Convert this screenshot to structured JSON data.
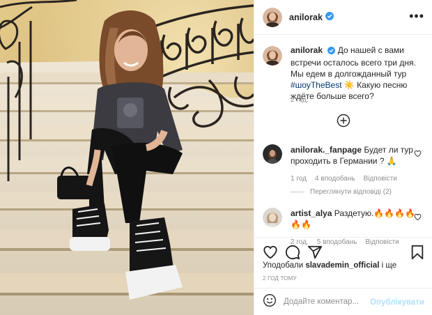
{
  "post": {
    "author": "anilorak",
    "verified": true,
    "caption": {
      "text": "До нашей с вами встречи осталось всего три дня. Мы едем в долгожданный тур",
      "hashtag": "#шоуTheBest",
      "emoji": "☀️",
      "text2": "Какую песню ждёте больше всего?"
    },
    "caption_time": "2 год.",
    "comments": [
      {
        "user": "anilorak._fanpage",
        "text": "Будет ли тур проходить в Германии ? 🙏",
        "time": "1 год",
        "likes": "4 вподобань",
        "reply": "Відповісти"
      },
      {
        "user": "artist_alya",
        "text": "Раздетую.🔥🔥🔥🔥🔥🔥",
        "time": "2 год.",
        "likes": "5 вподобань",
        "reply": "Відповісти"
      }
    ],
    "view_replies": "Переглянути відповіді (2)",
    "liked_by_prefix": "Уподобали",
    "liked_by_user": "slavademin_official",
    "liked_by_suffix": "і ще",
    "time_ago": "2 ГОД ТОМУ",
    "add_comment_placeholder": "Додайте коментар...",
    "publish_label": "Опублікувати"
  },
  "icons": {
    "like": "heart-icon",
    "comment": "comment-icon",
    "share": "share-icon",
    "save": "bookmark-icon",
    "more": "more-options-icon",
    "emoji": "emoji-icon",
    "load_more": "plus-circle-icon"
  },
  "colors": {
    "verified": "#3897f0",
    "link": "#00376b",
    "publish_disabled": "#b2dffc",
    "meta": "#8e8e8e"
  }
}
